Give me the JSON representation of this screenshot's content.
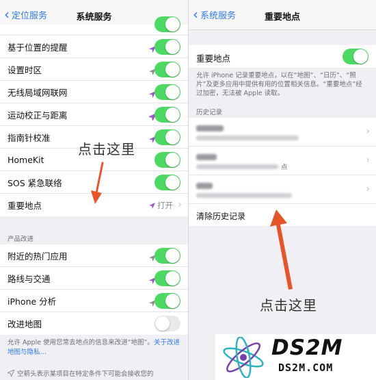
{
  "colors": {
    "accent": "#2f7bf5",
    "toggle_on": "#4cd964",
    "toggle_off": "#e9e9eb",
    "annotation_arrow": "#e8542a",
    "location_purple": "#9b59d0",
    "location_gray": "#8e8e93"
  },
  "left": {
    "back_label": "定位服务",
    "title": "系统服务",
    "rows": [
      {
        "label": "基于位置的提醒",
        "arrow": "purple-arrow-icon"
      },
      {
        "label": "设置时区",
        "arrow": "gray-arrow-icon"
      },
      {
        "label": "无线局域网联网",
        "arrow": "purple-arrow-icon"
      },
      {
        "label": "运动校正与距离",
        "arrow": "purple-arrow-icon"
      },
      {
        "label": "指南针校准",
        "arrow": "purple-arrow-icon"
      },
      {
        "label": "HomeKit",
        "arrow": ""
      },
      {
        "label": "SOS 紧急联络",
        "arrow": ""
      },
      {
        "label": "重要地点",
        "detail": "打开"
      }
    ],
    "section_header": "产品改进",
    "rows2": [
      {
        "label": "附近的热门应用",
        "arrow": "gray-arrow-icon",
        "on": true
      },
      {
        "label": "路线与交通",
        "arrow": "purple-arrow-icon",
        "on": true
      },
      {
        "label": "iPhone 分析",
        "arrow": "gray-arrow-icon",
        "on": true
      },
      {
        "label": "改进地图",
        "arrow": "",
        "on": false
      }
    ],
    "footer": "允许 Apple 使用您常去地点的信息来改进“地图”。",
    "footer_link": "关于改进地图与隐私…",
    "bottom_note": "空箭头表示某项目在特定条件下可能会接收您的"
  },
  "right": {
    "back_label": "系统服务",
    "title": "重要地点",
    "toggle_label": "重要地点",
    "description": "允许 iPhone 记录重要地点，以在“地图”、“日历”、“照片”及更多应用中提供有用的位置相关信息。“重要地点”经过加密，无法被 Apple 读取。",
    "history_header": "历史记录",
    "history_suffix": "点",
    "clear_history": "清除历史记录"
  },
  "annotations": {
    "left": "点击这里",
    "right": "点击这里"
  },
  "logo": {
    "main": "DS2M",
    "sub": "DS2M.COM"
  }
}
